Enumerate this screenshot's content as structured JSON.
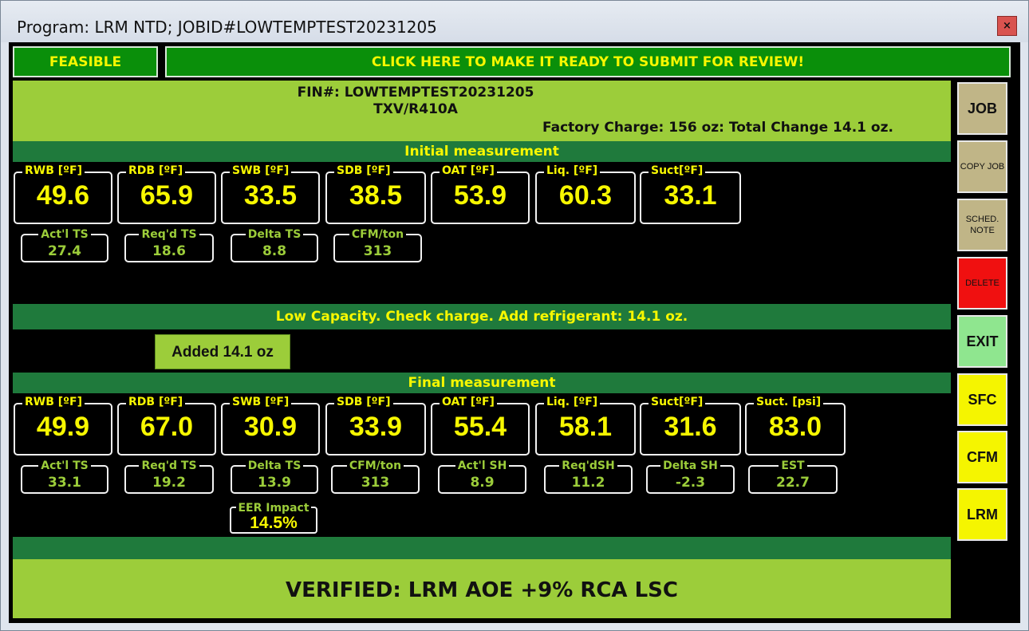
{
  "window": {
    "title": "Program: LRM NTD; JOBID#LOWTEMPTEST20231205",
    "close_glyph": "×"
  },
  "banners": {
    "feasible": "FEASIBLE",
    "submit": "CLICK HERE TO MAKE IT READY TO SUBMIT FOR REVIEW!"
  },
  "info": {
    "fin": "FIN#: LOWTEMPTEST20231205",
    "system": "TXV/R410A",
    "charge": "Factory Charge: 156 oz: Total Change 14.1 oz."
  },
  "sections": {
    "initial": "Initial measurement",
    "low_capacity": "Low Capacity. Check charge. Add refrigerant: 14.1 oz.",
    "final": "Final measurement"
  },
  "added_button": "Added 14.1 oz",
  "initial": {
    "big": [
      {
        "label": "RWB [ºF]",
        "value": "49.6"
      },
      {
        "label": "RDB [ºF]",
        "value": "65.9"
      },
      {
        "label": "SWB [ºF]",
        "value": "33.5"
      },
      {
        "label": "SDB [ºF]",
        "value": "38.5"
      },
      {
        "label": "OAT [ºF]",
        "value": "53.9"
      },
      {
        "label": "Liq. [ºF]",
        "value": "60.3"
      },
      {
        "label": "Suct[ºF]",
        "value": "33.1"
      }
    ],
    "small": [
      {
        "label": "Act'l TS",
        "value": "27.4"
      },
      {
        "label": "Req'd TS",
        "value": "18.6"
      },
      {
        "label": "Delta TS",
        "value": "8.8"
      },
      {
        "label": "CFM/ton",
        "value": "313"
      }
    ]
  },
  "final": {
    "big": [
      {
        "label": "RWB [ºF]",
        "value": "49.9"
      },
      {
        "label": "RDB [ºF]",
        "value": "67.0"
      },
      {
        "label": "SWB [ºF]",
        "value": "30.9"
      },
      {
        "label": "SDB [ºF]",
        "value": "33.9"
      },
      {
        "label": "OAT [ºF]",
        "value": "55.4"
      },
      {
        "label": "Liq. [ºF]",
        "value": "58.1"
      },
      {
        "label": "Suct[ºF]",
        "value": "31.6"
      },
      {
        "label": "Suct. [psi]",
        "value": "83.0"
      }
    ],
    "small": [
      {
        "label": "Act'l TS",
        "value": "33.1"
      },
      {
        "label": "Req'd TS",
        "value": "19.2"
      },
      {
        "label": "Delta TS",
        "value": "13.9"
      },
      {
        "label": "CFM/ton",
        "value": "313"
      },
      {
        "label": "Act'l SH",
        "value": "8.9"
      },
      {
        "label": "Req'dSH",
        "value": "11.2"
      },
      {
        "label": "Delta SH",
        "value": "-2.3"
      },
      {
        "label": "EST",
        "value": "22.7"
      }
    ],
    "eer": {
      "label": "EER Impact",
      "value": "14.5%"
    }
  },
  "verified": "VERIFIED: LRM AOE +9% RCA LSC",
  "sidebar": {
    "job": "JOB",
    "copy_job": "COPY JOB",
    "sched_note": "SCHED. NOTE",
    "delete": "DELETE",
    "exit": "EXIT",
    "sfc": "SFC",
    "cfm": "CFM",
    "lrm": "LRM"
  },
  "colors": {
    "banner_green": "#0a8f0a",
    "lime": "#9ccd3a",
    "section_green": "#1f7a3c",
    "value_yellow": "#f7f700",
    "delete_red": "#f01010",
    "exit_green": "#8fe68f",
    "tan": "#c0b587"
  }
}
